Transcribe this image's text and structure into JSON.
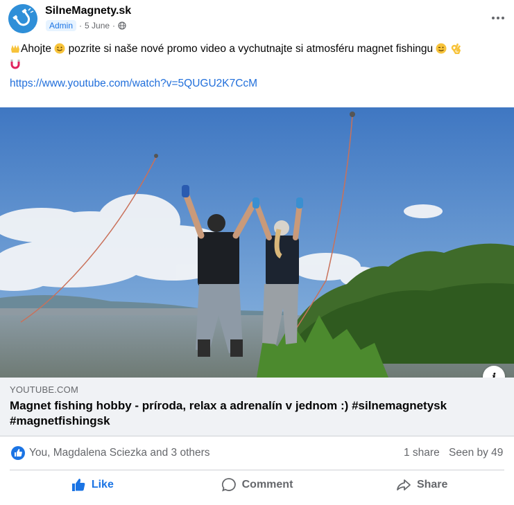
{
  "post": {
    "author": "SilneMagnety.sk",
    "badge": "Admin",
    "date": "5 June",
    "separator": "·",
    "text_parts": [
      "Ahojte",
      " pozrite si naše nové promo video a vychutnajte si atmosféru magnet fishingu"
    ],
    "link": "https://www.youtube.com/watch?v=5QUGU2K7CcM"
  },
  "link_preview": {
    "domain": "YOUTUBE.COM",
    "title": "Magnet fishing hobby - príroda, relax a adrenalín v jednom :) #silnemagnetysk #magnetfishingsk",
    "info_glyph": "i"
  },
  "engagement": {
    "reactions_text": "You, Magdalena Sciezka and 3 others",
    "shares": "1 share",
    "seen": "Seen by 49"
  },
  "actions": {
    "like": "Like",
    "comment": "Comment",
    "share": "Share"
  },
  "colors": {
    "accent": "#1b74e4",
    "link": "#216fdb",
    "muted": "#65676b"
  },
  "icons": [
    "magnet-avatar-icon",
    "globe-icon",
    "more-dots-icon",
    "raised-hands-emoji",
    "smile-emoji",
    "wink-emoji",
    "ok-hand-emoji",
    "magnet-emoji",
    "like-reaction-icon",
    "like-icon",
    "comment-icon",
    "share-icon"
  ]
}
